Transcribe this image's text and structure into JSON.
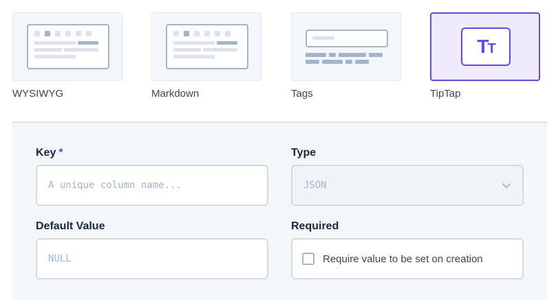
{
  "interfaces": [
    {
      "id": "wysiwyg",
      "label": "WYSIWYG",
      "icon": "wysiwyg-preview-icon",
      "active": false
    },
    {
      "id": "markdown",
      "label": "Markdown",
      "icon": "markdown-preview-icon",
      "active": false
    },
    {
      "id": "tags",
      "label": "Tags",
      "icon": "tags-preview-icon",
      "active": false
    },
    {
      "id": "tiptap",
      "label": "TipTap",
      "icon": "tiptap-text-icon",
      "active": true
    }
  ],
  "tiptap_icon_text": {
    "big": "T",
    "small": "T"
  },
  "form": {
    "key": {
      "label": "Key",
      "required_marker": "*",
      "placeholder": "A unique column name...",
      "value": ""
    },
    "type": {
      "label": "Type",
      "value": "JSON",
      "icon": "chevron-down-icon"
    },
    "default_value": {
      "label": "Default Value",
      "placeholder": "NULL",
      "value": ""
    },
    "required": {
      "label": "Required",
      "checkbox_label": "Require value to be set on creation",
      "checked": false
    }
  },
  "colors": {
    "accent": "#6644ff",
    "accent_bg": "#efebfd",
    "panel_bg": "#f4f7fa",
    "border": "#d3dae4",
    "muted": "#a2b5cd"
  }
}
